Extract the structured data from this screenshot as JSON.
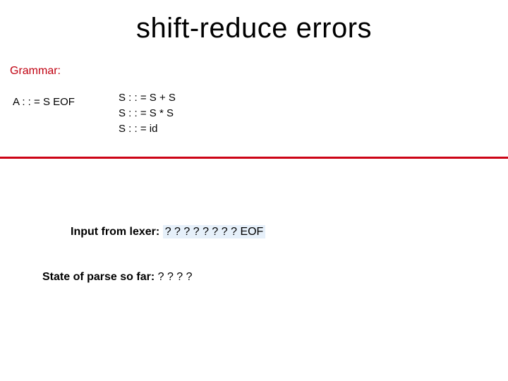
{
  "title": "shift-reduce errors",
  "grammar_label": "Grammar:",
  "rules": {
    "a": "A : : = S EOF",
    "s": "S : : = S + S\nS : : = S * S\nS : : = id"
  },
  "input_label": "Input from lexer:",
  "input_value": " ? ? ? ?  ? ? ? ? EOF ",
  "state_label": "State of parse so far:",
  "state_value": "  ? ? ? ?"
}
